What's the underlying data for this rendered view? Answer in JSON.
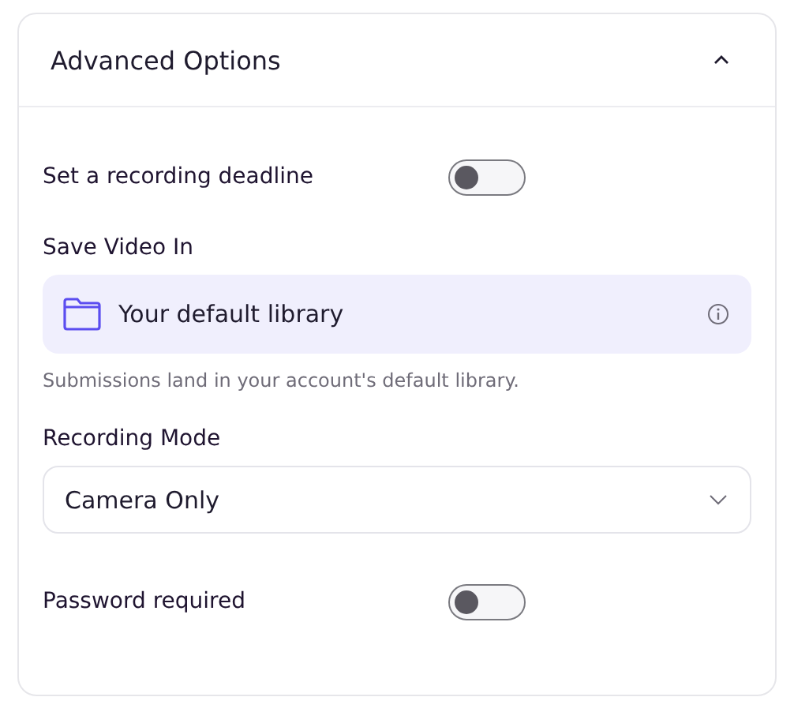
{
  "panel": {
    "title": "Advanced Options",
    "expanded": true
  },
  "deadline": {
    "label": "Set a recording deadline",
    "on": false
  },
  "save_location": {
    "label": "Save Video In",
    "value": "Your default library",
    "help": "Submissions land in your account's default library."
  },
  "recording_mode": {
    "label": "Recording Mode",
    "value": "Camera Only"
  },
  "password": {
    "label": "Password required",
    "on": false
  }
}
